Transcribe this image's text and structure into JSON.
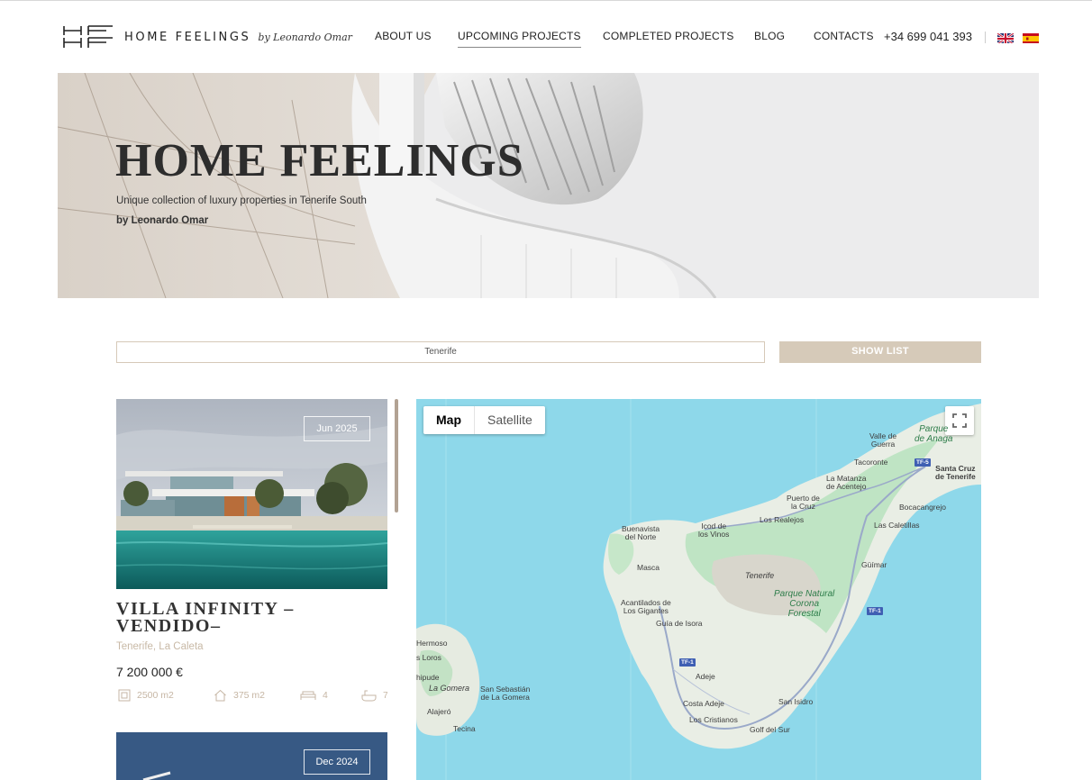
{
  "header": {
    "brand": "HOME FEELINGS",
    "brand_by": "by Leonardo Omar",
    "nav": [
      {
        "label": "ABOUT US"
      },
      {
        "label": "UPCOMING PROJECTS",
        "active": true
      },
      {
        "label": "COMPLETED PROJECTS"
      },
      {
        "label": "BLOG"
      },
      {
        "label": "CONTACTS"
      }
    ],
    "phone": "+34 699 041 393",
    "languages": [
      "english-flag-icon",
      "spanish-flag-icon"
    ]
  },
  "hero": {
    "title": "HOME FEELINGS",
    "subtitle": "Unique collection of luxury properties in Tenerife South",
    "byline": "by Leonardo Omar"
  },
  "search": {
    "value": "Tenerife",
    "show_list_label": "SHOW LIST"
  },
  "listings": [
    {
      "date": "Jun 2025",
      "title": "VILLA INFINITY –VENDIDO–",
      "location": "Tenerife, La Caleta",
      "price": "7 200 000 €",
      "plot": "2500 m2",
      "built": "375 m2",
      "bedrooms": "4",
      "bathrooms": "7"
    },
    {
      "date": "Dec 2024"
    }
  ],
  "map": {
    "type_map": "Map",
    "type_satellite": "Satellite",
    "places": {
      "valle_guerra": "Valle de\nGuerra",
      "parque_anaga": "Parque\nde Anaga",
      "tacoronte": "Tacoronte",
      "santa_cruz": "Santa Cruz\nde Tenerife",
      "la_matanza": "La Matanza\nde Acentejo",
      "puerto_cruz": "Puerto de\nla Cruz",
      "los_realejos": "Los Realejos",
      "bocacangrejo": "Bocacangrejo",
      "buenavista": "Buenavista\ndel Norte",
      "icod": "Icod de\nlos Vinos",
      "las_caletillas": "Las Caletillas",
      "masca": "Masca",
      "tenerife": "Tenerife",
      "guimar": "Güímar",
      "parque_teide": "Parque Natural\nCorona\nForestal",
      "acantilados": "Acantilados de\nLos Gigantes",
      "guia_isora": "Guía de Isora",
      "hermoso": "Hermoso",
      "los_loros": "s Loros",
      "adeje": "Adeje",
      "chipude": "hipude",
      "la_gomera": "La Gomera",
      "san_sebastian": "San Sebastián\nde La Gomera",
      "costa_adeje": "Costa Adeje",
      "san_isidro": "San Isidro",
      "alajero": "Alajeró",
      "los_cristianos": "Los Cristianos",
      "golf_sur": "Golf del Sur",
      "tecina": "Tecina"
    },
    "roads": {
      "tf5": "TF-5",
      "tf1a": "TF-1",
      "tf1b": "TF-1"
    }
  }
}
